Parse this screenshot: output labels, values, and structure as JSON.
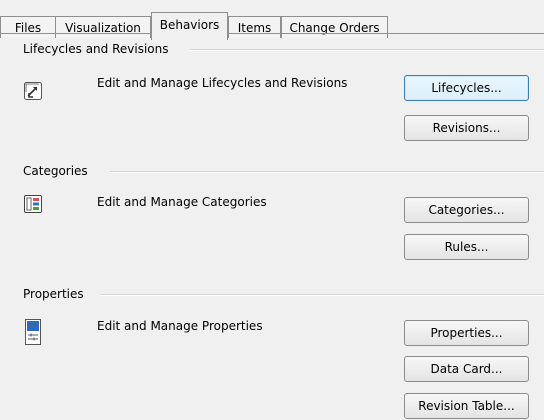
{
  "tabs": [
    {
      "label": "Files",
      "active": false
    },
    {
      "label": "Visualization",
      "active": false
    },
    {
      "label": "Behaviors",
      "active": true
    },
    {
      "label": "Items",
      "active": false
    },
    {
      "label": "Change Orders",
      "active": false
    }
  ],
  "sections": {
    "lifecycles": {
      "title": "Lifecycles and Revisions",
      "description": "Edit and Manage Lifecycles and Revisions",
      "icon": "lifecycle-arrows-icon",
      "buttons": [
        "Lifecycles...",
        "Revisions..."
      ]
    },
    "categories": {
      "title": "Categories",
      "description": "Edit and Manage Categories",
      "icon": "categories-icon",
      "buttons": [
        "Categories...",
        "Rules..."
      ]
    },
    "properties": {
      "title": "Properties",
      "description": "Edit and Manage Properties",
      "icon": "properties-icon",
      "buttons": [
        "Properties...",
        "Data Card...",
        "Revision Table..."
      ]
    }
  },
  "colors": {
    "window_bg": "#f0f0f0",
    "focus_border": "#3c7fb1",
    "category_red": "#d9534f",
    "category_blue": "#2e75b6",
    "category_green": "#3aa53a",
    "property_blue": "#2e6cb5"
  }
}
